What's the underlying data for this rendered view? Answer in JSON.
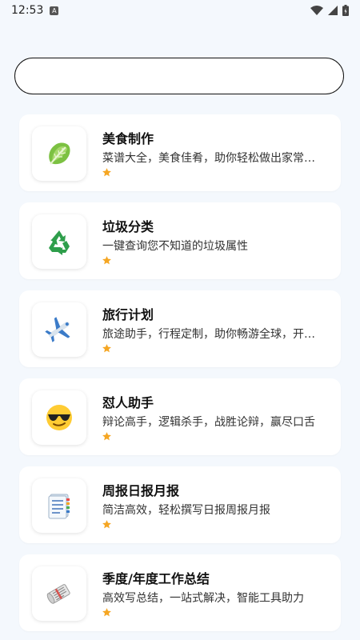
{
  "status_bar": {
    "time": "12:53",
    "notification_glyph": "A"
  },
  "search": {
    "value": "",
    "placeholder": ""
  },
  "cards": [
    {
      "title": "美食制作",
      "desc": "菜谱大全，美食佳肴，助你轻松做出家常美味",
      "icon": "lettuce-icon"
    },
    {
      "title": "垃圾分类",
      "desc": "一键查询您不知道的垃圾属性",
      "icon": "recycle-icon"
    },
    {
      "title": "旅行计划",
      "desc": "旅途助手，行程定制，助你畅游全球，开启美好旅程",
      "icon": "airplane-icon"
    },
    {
      "title": "怼人助手",
      "desc": "辩论高手，逻辑杀手，战胜论辩，赢尽口舌",
      "icon": "sunglasses-face-icon"
    },
    {
      "title": "周报日报月报",
      "desc": "简洁高效，轻松撰写日报周报月报",
      "icon": "notepad-icon"
    },
    {
      "title": "季度/年度工作总结",
      "desc": "高效写总结，一站式解决，智能工具助力",
      "icon": "newspaper-roll-icon"
    }
  ],
  "colors": {
    "star": "#f5a623",
    "background": "#f4f8fd"
  }
}
